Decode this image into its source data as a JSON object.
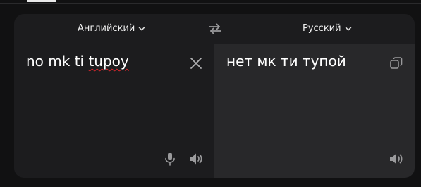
{
  "languages": {
    "source": "Английский",
    "target": "Русский"
  },
  "source": {
    "text_part1": "no mk ti ",
    "text_misspelled": "tupoy"
  },
  "target": {
    "text": "нет мк ти тупой"
  },
  "icons": {
    "swap": "swap-arrows-icon",
    "clear": "close-icon",
    "copy": "copy-icon",
    "mic": "microphone-icon",
    "speaker": "speaker-icon",
    "chevron": "chevron-down-icon"
  },
  "colors": {
    "background": "#111112",
    "panel": "#1c1c1e",
    "target_pane": "#28282a",
    "text": "#ffffff",
    "icon": "#9a9a9c",
    "spellcheck": "#d8262c"
  }
}
